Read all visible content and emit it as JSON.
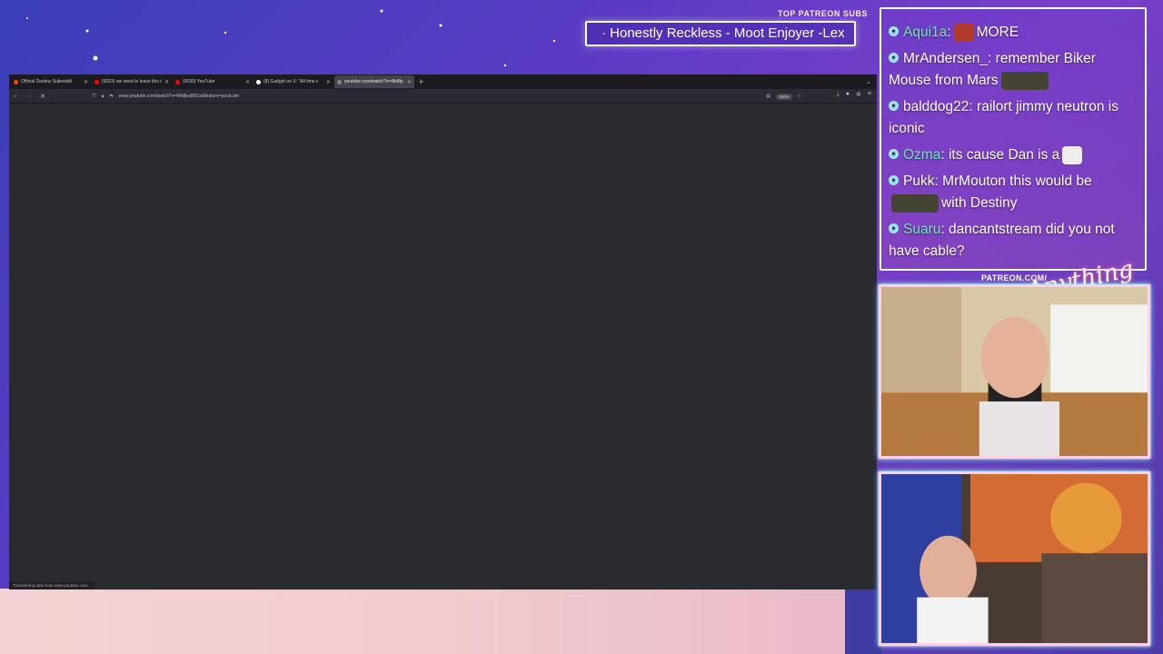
{
  "overlay": {
    "top_patreon_label": "TOP PATREON SUBS",
    "ticker_text": "· Honestly Reckless - Moot Enjoyer -Lex",
    "patreon_label": "PATREON.COM/",
    "brand_script": "Anything else"
  },
  "browser": {
    "tabs": [
      {
        "title": "Official Destiny Subreddit",
        "favicon_color": "#ff4500",
        "active": false
      },
      {
        "title": "(6023) we need to leave this to",
        "favicon_color": "#ff0000",
        "active": false
      },
      {
        "title": "(6030) YouTube",
        "favicon_color": "#ff0000",
        "active": false
      },
      {
        "title": "(8) Gadget on X: \"All time c",
        "favicon_color": "#ffffff",
        "active": false
      },
      {
        "title": "youtube.com/watch?v=4lhl8p",
        "favicon_color": "#888888",
        "active": true
      }
    ],
    "new_tab_icon": "+",
    "url": "www.youtube.com/watch?v=4lhl8pa86Gs&feature=youtu.be",
    "zoom": "160%",
    "status_text": "Transferring data from www.youtube.com..."
  },
  "chat": {
    "messages": [
      {
        "name": "Aqui1a",
        "name_color": "teal",
        "text": "MORE",
        "emote_before_text": true
      },
      {
        "name": "MrAndersen_",
        "name_color": "white",
        "text": "remember Biker Mouse from Mars",
        "emote_after_text": true
      },
      {
        "name": "balddog22",
        "name_color": "white",
        "text": "railort jimmy neutron is iconic"
      },
      {
        "name": "Ozma",
        "name_color": "teal",
        "text": "its cause Dan is a",
        "emote_after_text": true
      },
      {
        "name": "Pukk",
        "name_color": "white",
        "text": "MrMouton this would be",
        "text2": "with Destiny"
      },
      {
        "name": "Suaru",
        "name_color": "teal",
        "text": "dancantstream did you not have cable?"
      }
    ]
  }
}
